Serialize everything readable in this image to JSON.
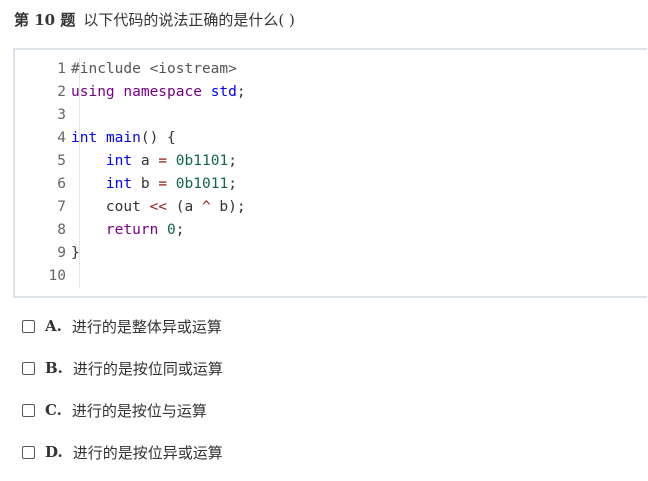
{
  "question": {
    "number": "第 10 题",
    "text": "以下代码的说法正确的是什么( )"
  },
  "code": {
    "line_numbers": [
      "1",
      "2",
      "3",
      "4",
      "5",
      "6",
      "7",
      "8",
      "9",
      "10"
    ],
    "lines": [
      [
        {
          "t": "#include <iostream>",
          "c": "inc"
        }
      ],
      [
        {
          "t": "using",
          "c": "kw"
        },
        {
          "t": " "
        },
        {
          "t": "namespace",
          "c": "kw"
        },
        {
          "t": " "
        },
        {
          "t": "std",
          "c": "ns"
        },
        {
          "t": ";"
        }
      ],
      [],
      [
        {
          "t": "int",
          "c": "ty"
        },
        {
          "t": " "
        },
        {
          "t": "main",
          "c": "ns"
        },
        {
          "t": "() {"
        }
      ],
      [
        {
          "t": "    "
        },
        {
          "t": "int",
          "c": "ty"
        },
        {
          "t": " a "
        },
        {
          "t": "=",
          "c": "op"
        },
        {
          "t": " "
        },
        {
          "t": "0b1101",
          "c": "nm"
        },
        {
          "t": ";"
        }
      ],
      [
        {
          "t": "    "
        },
        {
          "t": "int",
          "c": "ty"
        },
        {
          "t": " b "
        },
        {
          "t": "=",
          "c": "op"
        },
        {
          "t": " "
        },
        {
          "t": "0b1011",
          "c": "nm"
        },
        {
          "t": ";"
        }
      ],
      [
        {
          "t": "    cout "
        },
        {
          "t": "<<",
          "c": "op"
        },
        {
          "t": " (a "
        },
        {
          "t": "^",
          "c": "op"
        },
        {
          "t": " b);"
        }
      ],
      [
        {
          "t": "    "
        },
        {
          "t": "return",
          "c": "kw"
        },
        {
          "t": " "
        },
        {
          "t": "0",
          "c": "nm"
        },
        {
          "t": ";"
        }
      ],
      [
        {
          "t": "}"
        }
      ],
      []
    ]
  },
  "options": [
    {
      "letter": "A.",
      "text": "进行的是整体异或运算"
    },
    {
      "letter": "B.",
      "text": "进行的是按位同或运算"
    },
    {
      "letter": "C.",
      "text": "进行的是按位与运算"
    },
    {
      "letter": "D.",
      "text": "进行的是按位异或运算"
    }
  ]
}
